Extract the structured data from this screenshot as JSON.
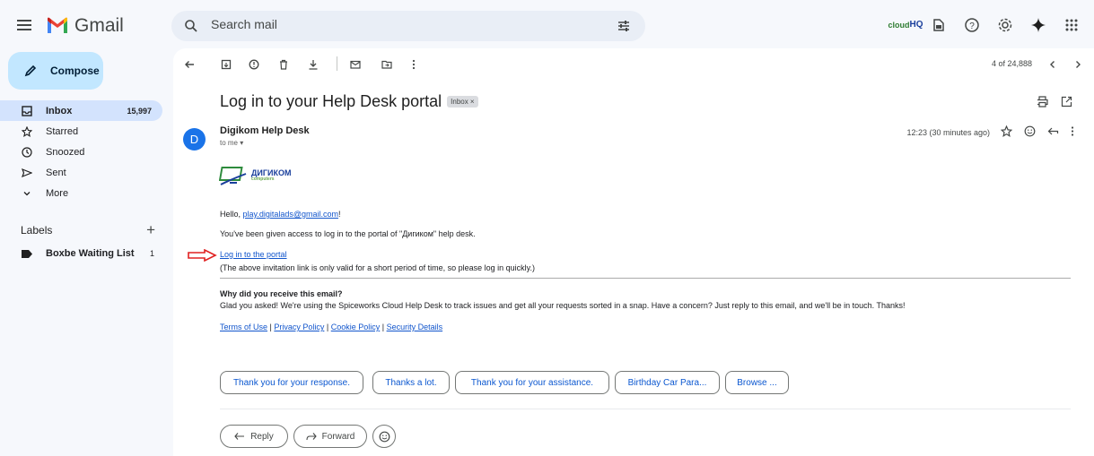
{
  "header": {
    "app_name": "Gmail",
    "search_placeholder": "Search mail",
    "cloudhq_top": "cloud",
    "cloudhq_bottom": "HQ"
  },
  "sidebar": {
    "compose_label": "Compose",
    "items": [
      {
        "label": "Inbox",
        "count": "15,997",
        "icon": "inbox-icon"
      },
      {
        "label": "Starred",
        "icon": "star-icon"
      },
      {
        "label": "Snoozed",
        "icon": "clock-icon"
      },
      {
        "label": "Sent",
        "icon": "send-icon"
      },
      {
        "label": "More",
        "icon": "chevron-down-icon"
      }
    ],
    "labels_title": "Labels",
    "labels": [
      {
        "label": "Boxbe Waiting List",
        "count": "1"
      }
    ]
  },
  "toolbar": {
    "pager": "4 of 24,888"
  },
  "message": {
    "subject": "Log in to your Help Desk portal",
    "label_chip": "Inbox ×",
    "avatar_letter": "D",
    "sender": "Digikom Help Desk",
    "to": "to me ▾",
    "time": "12:23 (30 minutes ago)",
    "logo_text": "ДИГИКОМ",
    "logo_sub": "computers",
    "greeting_prefix": "Hello, ",
    "greeting_email": "play.digitalads@gmail.com",
    "greeting_suffix": "!",
    "access_line": "You've been given access to log in to the portal of \"Дигиком\" help desk.",
    "login_link": "Log in to the portal",
    "validity_note": "(The above invitation link is only valid for a short period of time, so please log in quickly.)",
    "why_title": "Why did you receive this email?",
    "why_body": "Glad you asked! We're using the Spiceworks Cloud Help Desk to track issues and get all your requests sorted in a snap. Have a concern? Just reply to this email, and we'll be in touch. Thanks!",
    "footer_links": {
      "terms": "Terms of Use",
      "privacy": "Privacy Policy",
      "cookie": "Cookie Policy",
      "security": "Security Details",
      "sep": " | "
    }
  },
  "smart_replies": [
    "Thank you for your response.",
    "Thanks a lot.",
    "Thank you for your assistance.",
    "Birthday Car Para...",
    "Browse ..."
  ],
  "actions": {
    "reply": "Reply",
    "forward": "Forward"
  }
}
